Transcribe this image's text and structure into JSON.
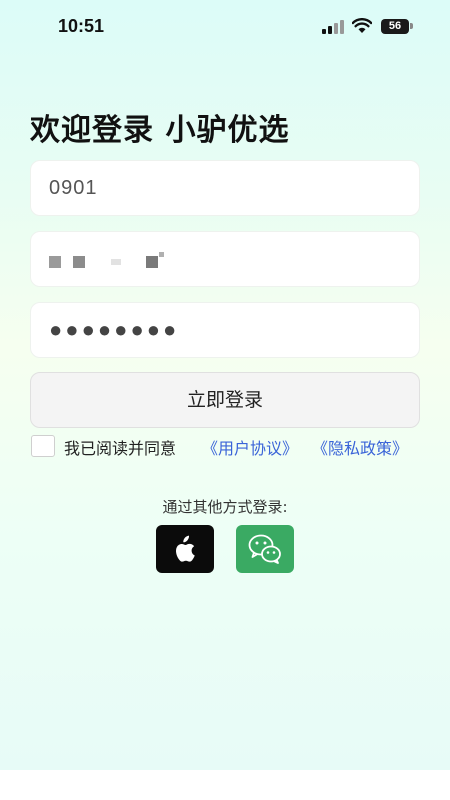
{
  "status_bar": {
    "time": "10:51",
    "battery": "56"
  },
  "login": {
    "title": "欢迎登录 小驴优选",
    "account_value": "0901",
    "password_value": "●●●●●●●●",
    "submit_label": "立即登录"
  },
  "agreement": {
    "text": "我已阅读并同意",
    "terms_link": "《用户协议》",
    "privacy_link": "《隐私政策》"
  },
  "other_login": {
    "label": "通过其他方式登录:",
    "apple_icon": "apple-logo-icon",
    "wechat_icon": "wechat-logo-icon"
  },
  "colors": {
    "accent_link": "#3a64d8",
    "wechat_green": "#3aaa63",
    "apple_black": "#0b0b0b"
  }
}
